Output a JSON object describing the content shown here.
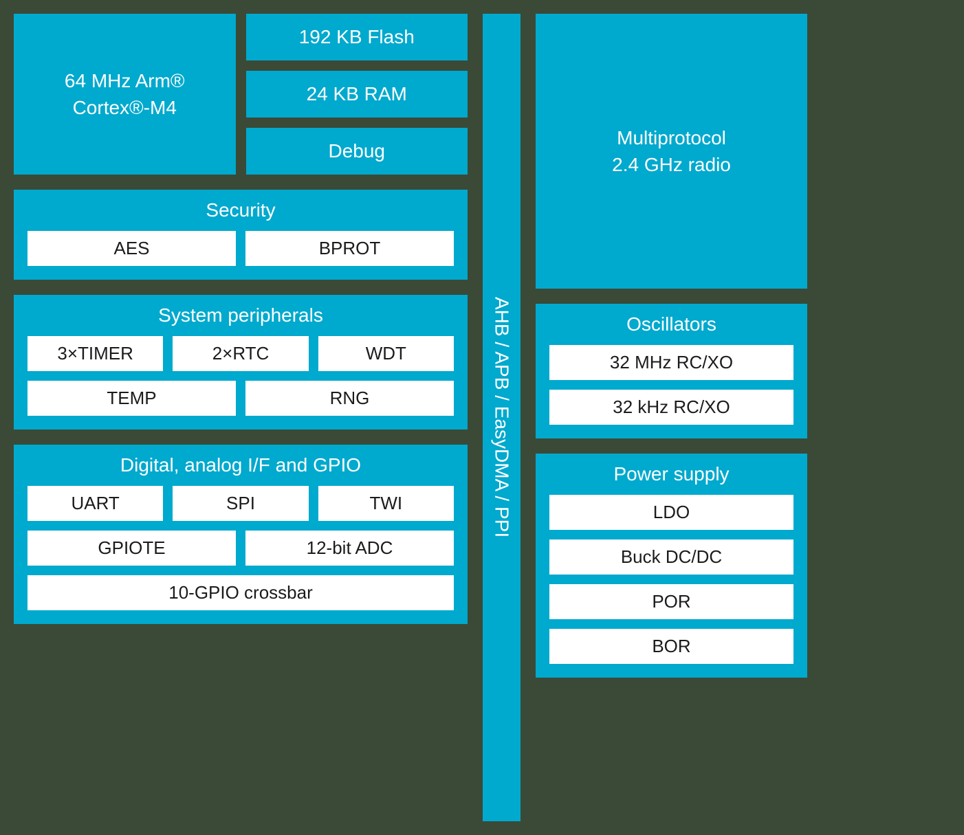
{
  "cpu": {
    "line1": "64 MHz Arm®",
    "line2": "Cortex®-M4"
  },
  "memory": {
    "flash": "192 KB Flash",
    "ram": "24 KB RAM",
    "debug": "Debug"
  },
  "security": {
    "title": "Security",
    "items": [
      "AES",
      "BPROT"
    ]
  },
  "sysperiph": {
    "title": "System peripherals",
    "row1": [
      "3×TIMER",
      "2×RTC",
      "WDT"
    ],
    "row2": [
      "TEMP",
      "RNG"
    ]
  },
  "io": {
    "title": "Digital, analog I/F and GPIO",
    "row1": [
      "UART",
      "SPI",
      "TWI"
    ],
    "row2": [
      "GPIOTE",
      "12-bit ADC"
    ],
    "row3": [
      "10-GPIO crossbar"
    ]
  },
  "bus": "AHB / APB / EasyDMA / PPI",
  "radio": {
    "line1": "Multiprotocol",
    "line2": "2.4 GHz radio"
  },
  "oscillators": {
    "title": "Oscillators",
    "items": [
      "32 MHz RC/XO",
      "32 kHz RC/XO"
    ]
  },
  "power": {
    "title": "Power supply",
    "items": [
      "LDO",
      "Buck DC/DC",
      "POR",
      "BOR"
    ]
  }
}
